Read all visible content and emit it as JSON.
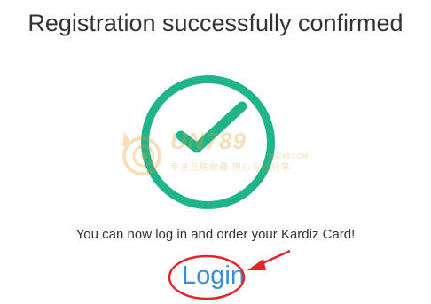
{
  "page": {
    "title": "Registration successfully confirmed",
    "message": "You can now log in and order your Kardiz Card!",
    "login_link": "Login"
  },
  "icons": {
    "success": "check-circle-icon"
  },
  "watermark": {
    "main": "UN789",
    "domain": "UN789.COM",
    "tagline": "专注互联收藏  用心与您分享"
  },
  "colors": {
    "success": "#1fb489",
    "link": "#3b8fd6",
    "annotation": "#e3242b",
    "watermark": "#ef9a2c",
    "text": "#333333"
  }
}
